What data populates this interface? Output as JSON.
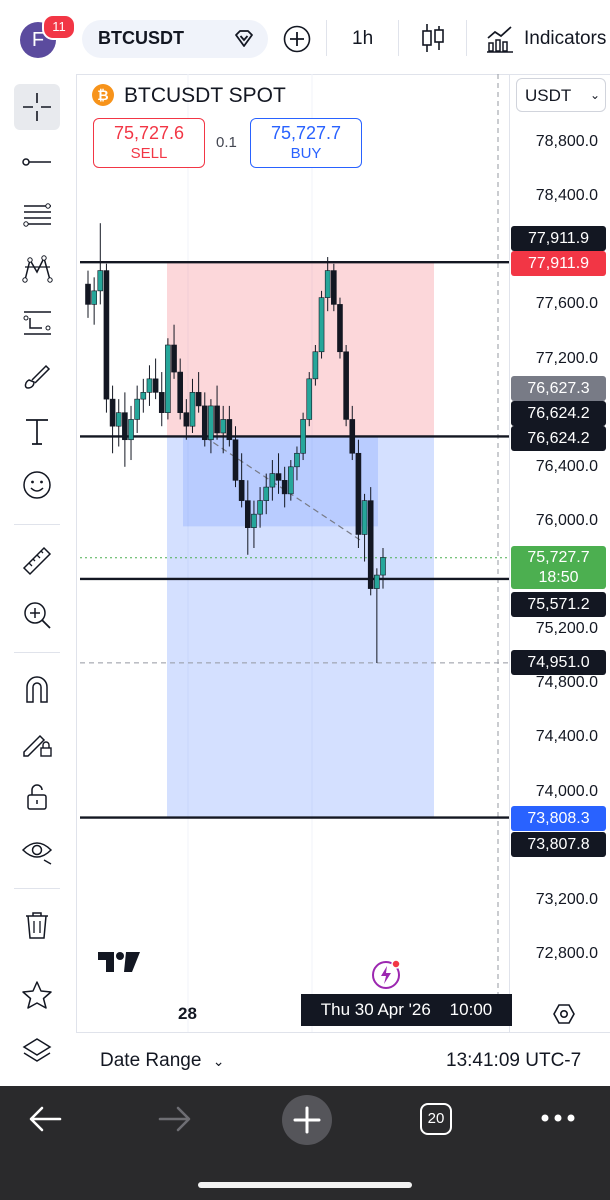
{
  "topbar": {
    "avatar_letter": "F",
    "notification_count": "11",
    "symbol": "BTCUSDT",
    "interval": "1h",
    "indicators_label": "Indicators"
  },
  "chart": {
    "title": "BTCUSDT SPOT",
    "sell_price": "75,727.6",
    "sell_label": "SELL",
    "spread": "0.1",
    "buy_price": "75,727.7",
    "buy_label": "BUY",
    "currency": "USDT",
    "price_ticks": [
      "78,800.0",
      "78,400.0",
      "77,600.0",
      "77,200.0",
      "76,400.0",
      "76,000.0",
      "75,200.0",
      "74,800.0",
      "74,400.0",
      "74,000.0",
      "73,200.0",
      "72,800.0"
    ],
    "tags": {
      "top_line_black": "77,911.9",
      "top_line_red": "77,911.9",
      "gray": "76,627.3",
      "entry_black_1": "76,624.2",
      "entry_black_2": "76,624.2",
      "last_price": "75,727.7",
      "countdown": "18:50",
      "line_575": "75,571.2",
      "crosshair": "74,951.0",
      "stop_blue": "73,808.3",
      "stop_black": "73,807.8"
    },
    "time_label": "28",
    "crosshair_time": "Thu 30 Apr '26    10:00",
    "colors": {
      "up": "#089981",
      "down": "#131722",
      "sell": "#f23645",
      "buy": "#2962ff",
      "last": "#4caf50"
    }
  },
  "footer": {
    "date_range": "Date Range",
    "clock": "13:41:09 UTC-7"
  },
  "browser": {
    "tabs_count": "20"
  },
  "chart_data": {
    "type": "candlestick",
    "symbol": "BTCUSDT",
    "interval": "1h",
    "ylim": [
      72600,
      79000
    ],
    "long_position": {
      "entry": 76624.2,
      "target": 77911.9,
      "stop": 73808.3
    },
    "horizontal_lines": [
      77911.9,
      76624.2,
      75571.2,
      73807.8
    ],
    "last_price": 75727.7,
    "candles": [
      [
        77750,
        77850,
        77500,
        77600
      ],
      [
        77600,
        77800,
        77450,
        77700
      ],
      [
        77700,
        78200,
        77600,
        77850
      ],
      [
        77850,
        77900,
        76800,
        76900
      ],
      [
        76900,
        77000,
        76500,
        76700
      ],
      [
        76700,
        76900,
        76550,
        76800
      ],
      [
        76800,
        76950,
        76400,
        76600
      ],
      [
        76600,
        76850,
        76450,
        76750
      ],
      [
        76750,
        77000,
        76650,
        76900
      ],
      [
        76900,
        77050,
        76800,
        76950
      ],
      [
        76950,
        77150,
        76850,
        77050
      ],
      [
        77050,
        77200,
        76900,
        76950
      ],
      [
        76950,
        77100,
        76700,
        76800
      ],
      [
        76800,
        77350,
        76750,
        77300
      ],
      [
        77300,
        77450,
        77050,
        77100
      ],
      [
        77100,
        77200,
        76750,
        76800
      ],
      [
        76800,
        76900,
        76600,
        76700
      ],
      [
        76700,
        77050,
        76650,
        76950
      ],
      [
        76950,
        77100,
        76800,
        76850
      ],
      [
        76850,
        76950,
        76550,
        76600
      ],
      [
        76600,
        76900,
        76500,
        76850
      ],
      [
        76850,
        77000,
        76600,
        76650
      ],
      [
        76650,
        76850,
        76500,
        76750
      ],
      [
        76750,
        76850,
        76550,
        76600
      ],
      [
        76600,
        76700,
        76250,
        76300
      ],
      [
        76300,
        76500,
        76100,
        76150
      ],
      [
        76150,
        76300,
        75750,
        75950
      ],
      [
        75950,
        76150,
        75800,
        76050
      ],
      [
        76050,
        76250,
        75950,
        76150
      ],
      [
        76150,
        76350,
        76050,
        76250
      ],
      [
        76250,
        76450,
        76150,
        76350
      ],
      [
        76350,
        76500,
        76200,
        76300
      ],
      [
        76300,
        76400,
        76100,
        76200
      ],
      [
        76200,
        76450,
        76150,
        76400
      ],
      [
        76400,
        76550,
        76300,
        76500
      ],
      [
        76500,
        76800,
        76450,
        76750
      ],
      [
        76750,
        77100,
        76700,
        77050
      ],
      [
        77050,
        77300,
        77000,
        77250
      ],
      [
        77250,
        77700,
        77200,
        77650
      ],
      [
        77650,
        77950,
        77550,
        77850
      ],
      [
        77850,
        77900,
        77550,
        77600
      ],
      [
        77600,
        77650,
        77200,
        77250
      ],
      [
        77250,
        77300,
        76700,
        76750
      ],
      [
        76750,
        76850,
        76450,
        76500
      ],
      [
        76500,
        76600,
        75800,
        75900
      ],
      [
        75900,
        76200,
        75700,
        76150
      ],
      [
        76150,
        76250,
        75450,
        75500
      ],
      [
        75500,
        75650,
        74950,
        75600
      ],
      [
        75600,
        75800,
        75500,
        75730
      ]
    ]
  }
}
